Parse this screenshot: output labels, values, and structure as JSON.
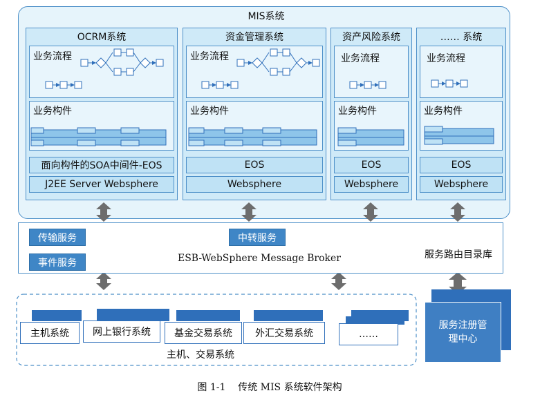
{
  "mis": {
    "title": "MIS系统",
    "columns": [
      {
        "title": "OCRM系统",
        "flow_label": "业务流程",
        "comp_label": "业务构件",
        "middleware": "面向构件的SOA中间件-EOS",
        "server": "J2EE Server Websphere"
      },
      {
        "title": "资金管理系统",
        "flow_label": "业务流程",
        "comp_label": "业务构件",
        "middleware": "EOS",
        "server": "Websphere"
      },
      {
        "title": "资产风险系统",
        "flow_label": "业务流程",
        "comp_label": "业务构件",
        "middleware": "EOS",
        "server": "Websphere"
      },
      {
        "title": "…… 系统",
        "flow_label": "业务流程",
        "comp_label": "业务构件",
        "middleware": "EOS",
        "server": "Websphere"
      }
    ]
  },
  "esb": {
    "title": "ESB-WebSphere Message Broker",
    "transport": "传输服务",
    "relay": "中转服务",
    "event": "事件服务",
    "routing": "服务路由目录库"
  },
  "host": {
    "group_label": "主机、交易系统",
    "systems": [
      "主机系统",
      "网上银行系统",
      "基金交易系统",
      "外汇交易系统",
      "……"
    ]
  },
  "registry": {
    "label": "服务注册管理中心"
  },
  "caption": "图 1-1    传统 MIS 系统软件架构",
  "colors": {
    "accent": "#3f86c6",
    "dark_blue": "#2f6fba",
    "panel": "#cfeaf8",
    "arrow": "#6d6d6d"
  }
}
